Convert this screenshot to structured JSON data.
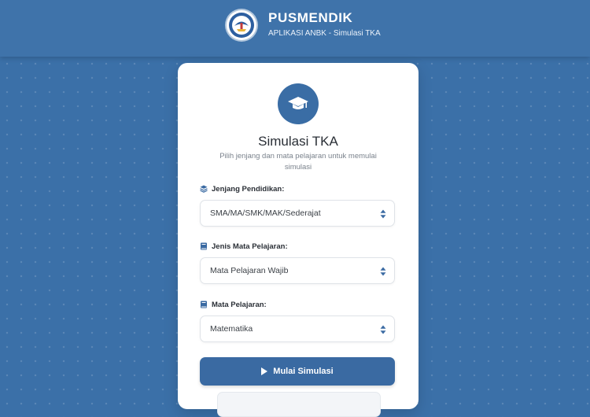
{
  "header": {
    "title": "PUSMENDIK",
    "subtitle": "APLIKASI ANBK - Simulasi TKA",
    "logo_icon": "tut-wuri-handayani-logo"
  },
  "card": {
    "icon": "graduation-cap-icon",
    "title": "Simulasi TKA",
    "subtitle": "Pilih jenjang dan mata pelajaran untuk memulai simulasi",
    "fields": [
      {
        "label": "Jenjang Pendidikan:",
        "icon": "layers-icon",
        "value": "SMA/MA/SMK/MAK/Sederajat"
      },
      {
        "label": "Jenis Mata Pelajaran:",
        "icon": "book-icon",
        "value": "Mata Pelajaran Wajib"
      },
      {
        "label": "Mata Pelajaran:",
        "icon": "book-icon",
        "value": "Matematika"
      }
    ],
    "start_button": "Mulai Simulasi"
  },
  "colors": {
    "background": "#3b70a8",
    "accent": "#3a6aa2",
    "card": "#ffffff"
  }
}
